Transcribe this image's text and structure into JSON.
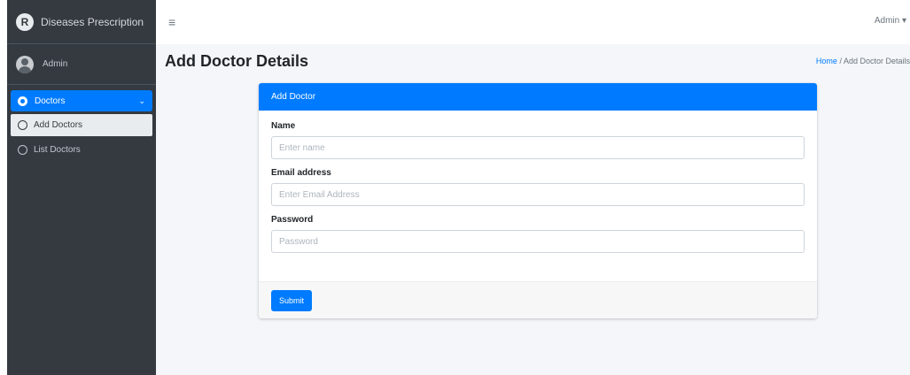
{
  "brand": {
    "name": "Diseases Prescription",
    "logo_letter": "R"
  },
  "user": {
    "name": "Admin"
  },
  "sidebar": {
    "menu": {
      "label": "Doctors",
      "icon": "user-group-icon"
    },
    "items": [
      {
        "label": "Add Doctors",
        "icon": "circle-icon"
      },
      {
        "label": "List Doctors",
        "icon": "circle-icon"
      }
    ]
  },
  "topbar": {
    "menu_icon": "≡",
    "admin_label": "Admin ▾"
  },
  "page": {
    "title": "Add Doctor Details",
    "breadcrumb": {
      "home": "Home",
      "separator": " / ",
      "current": "Add Doctor Details"
    }
  },
  "card": {
    "title": "Add Doctor",
    "submit_label": "Submit"
  },
  "form": {
    "name": {
      "label": "Name",
      "placeholder": "Enter name"
    },
    "email": {
      "label": "Email address",
      "placeholder": "Enter Email Address"
    },
    "password": {
      "label": "Password",
      "placeholder": "Password"
    }
  },
  "colors": {
    "primary": "#007bff",
    "sidebar_bg": "#343a40",
    "content_bg": "#f4f6f9"
  }
}
